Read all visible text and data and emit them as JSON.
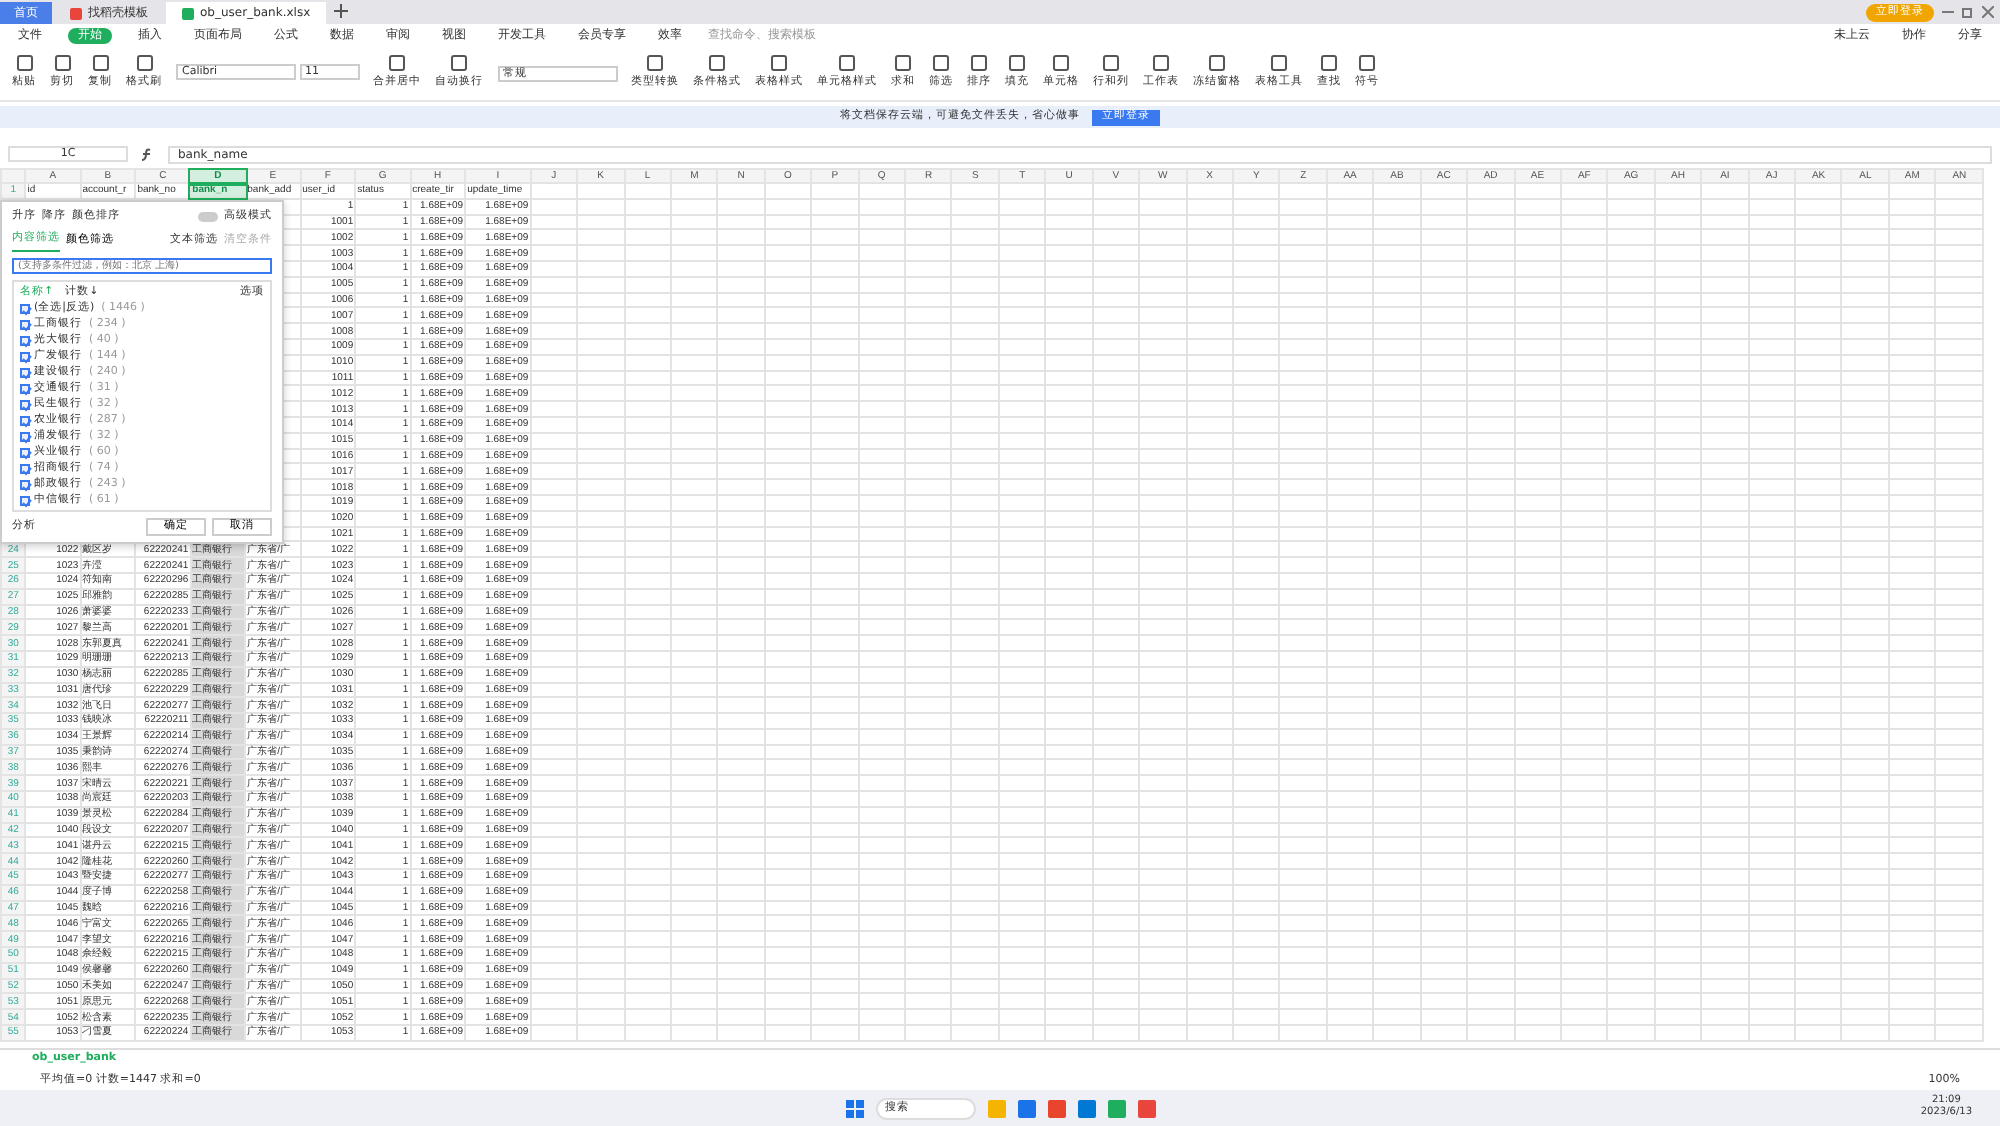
{
  "tabs": [
    {
      "label": "首页",
      "selected": false,
      "kind": "home"
    },
    {
      "label": "找稻壳模板",
      "selected": false,
      "kind": "template"
    },
    {
      "label": "ob_user_bank.xlsx",
      "selected": true,
      "kind": "sheet"
    }
  ],
  "login_button": "立即登录",
  "menu": {
    "file": "文件",
    "items": [
      {
        "label": "开始",
        "selected": true
      },
      {
        "label": "插入",
        "selected": false
      },
      {
        "label": "页面布局",
        "selected": false
      },
      {
        "label": "公式",
        "selected": false
      },
      {
        "label": "数据",
        "selected": false
      },
      {
        "label": "审阅",
        "selected": false
      },
      {
        "label": "视图",
        "selected": false
      },
      {
        "label": "开发工具",
        "selected": false
      },
      {
        "label": "会员专享",
        "selected": false
      },
      {
        "label": "效率",
        "selected": false
      }
    ],
    "search_placeholder": "查找命令、搜索模板",
    "actions": [
      "未上云",
      "协作",
      "分享"
    ]
  },
  "ribbon": {
    "clipboard": [
      "粘贴",
      "剪切",
      "复制",
      "格式刷"
    ],
    "font_name": "Calibri",
    "font_size": "11",
    "align": [
      "合并居中",
      "自动换行"
    ],
    "number_format": "常规",
    "tools": [
      "类型转换",
      "条件格式",
      "表格样式",
      "单元格样式",
      "求和",
      "筛选",
      "排序",
      "填充",
      "单元格",
      "行和列",
      "工作表",
      "冻结窗格",
      "表格工具",
      "查找",
      "符号"
    ]
  },
  "notice": {
    "text": "将文档保存云端，可避免文件丢失，省心做事",
    "button": "立即登录"
  },
  "name_box": "1C",
  "formula": "bank_name",
  "columns": [
    {
      "label": "A",
      "selected": false
    },
    {
      "label": "B",
      "selected": false
    },
    {
      "label": "C",
      "selected": false
    },
    {
      "label": "D",
      "selected": true
    },
    {
      "label": "E",
      "selected": false
    },
    {
      "label": "F",
      "selected": false
    },
    {
      "label": "G",
      "selected": false
    },
    {
      "label": "H",
      "selected": false
    },
    {
      "label": "I",
      "selected": false
    },
    {
      "label": "J",
      "selected": false
    },
    {
      "label": "K",
      "selected": false
    },
    {
      "label": "L",
      "selected": false
    },
    {
      "label": "M",
      "selected": false
    },
    {
      "label": "N",
      "selected": false
    },
    {
      "label": "O",
      "selected": false
    },
    {
      "label": "P",
      "selected": false
    },
    {
      "label": "Q",
      "selected": false
    },
    {
      "label": "R",
      "selected": false
    },
    {
      "label": "S",
      "selected": false
    },
    {
      "label": "T",
      "selected": false
    },
    {
      "label": "U",
      "selected": false
    },
    {
      "label": "V",
      "selected": false
    },
    {
      "label": "W",
      "selected": false
    },
    {
      "label": "X",
      "selected": false
    },
    {
      "label": "Y",
      "selected": false
    },
    {
      "label": "Z",
      "selected": false
    },
    {
      "label": "AA",
      "selected": false
    },
    {
      "label": "AB",
      "selected": false
    },
    {
      "label": "AC",
      "selected": false
    },
    {
      "label": "AD",
      "selected": false
    },
    {
      "label": "AE",
      "selected": false
    },
    {
      "label": "AF",
      "selected": false
    },
    {
      "label": "AG",
      "selected": false
    },
    {
      "label": "AH",
      "selected": false
    },
    {
      "label": "AI",
      "selected": false
    },
    {
      "label": "AJ",
      "selected": false
    },
    {
      "label": "AK",
      "selected": false
    },
    {
      "label": "AL",
      "selected": false
    },
    {
      "label": "AM",
      "selected": false
    },
    {
      "label": "AN",
      "selected": false
    }
  ],
  "header_row_number": "1",
  "header_row": [
    "id",
    "account_r",
    "bank_no",
    "bank_n",
    "bank_add",
    "user_id",
    "status",
    "create_tir",
    "update_time"
  ],
  "rows": [
    {
      "cells": [
        "1",
        "1",
        "1.68E+09",
        "1.68E+09"
      ]
    },
    {
      "cells": [
        "1001",
        "1",
        "1.68E+09",
        "1.68E+09"
      ]
    },
    {
      "cells": [
        "1002",
        "1",
        "1.68E+09",
        "1.68E+09"
      ]
    },
    {
      "cells": [
        "1003",
        "1",
        "1.68E+09",
        "1.68E+09"
      ]
    },
    {
      "cells": [
        "1004",
        "1",
        "1.68E+09",
        "1.68E+09"
      ]
    },
    {
      "cells": [
        "1005",
        "1",
        "1.68E+09",
        "1.68E+09"
      ]
    },
    {
      "cells": [
        "1006",
        "1",
        "1.68E+09",
        "1.68E+09"
      ]
    },
    {
      "cells": [
        "1007",
        "1",
        "1.68E+09",
        "1.68E+09"
      ]
    },
    {
      "cells": [
        "1008",
        "1",
        "1.68E+09",
        "1.68E+09"
      ]
    },
    {
      "cells": [
        "1009",
        "1",
        "1.68E+09",
        "1.68E+09"
      ]
    },
    {
      "cells": [
        "1010",
        "1",
        "1.68E+09",
        "1.68E+09"
      ]
    },
    {
      "cells": [
        "1011",
        "1",
        "1.68E+09",
        "1.68E+09"
      ]
    },
    {
      "cells": [
        "1012",
        "1",
        "1.68E+09",
        "1.68E+09"
      ]
    },
    {
      "cells": [
        "1013",
        "1",
        "1.68E+09",
        "1.68E+09"
      ]
    },
    {
      "cells": [
        "1014",
        "1",
        "1.68E+09",
        "1.68E+09"
      ]
    },
    {
      "cells": [
        "1015",
        "1",
        "1.68E+09",
        "1.68E+09"
      ]
    },
    {
      "cells": [
        "1016",
        "1",
        "1.68E+09",
        "1.68E+09"
      ]
    },
    {
      "cells": [
        "1017",
        "1",
        "1.68E+09",
        "1.68E+09"
      ]
    },
    {
      "cells": [
        "1018",
        "1",
        "1.68E+09",
        "1.68E+09"
      ]
    },
    {
      "cells": [
        "1019",
        "1",
        "1.68E+09",
        "1.68E+09"
      ]
    },
    {
      "cells": [
        "1020",
        "1",
        "1.68E+09",
        "1.68E+09"
      ]
    },
    {
      "cells": [
        "1021",
        "1",
        "1.68E+09",
        "1.68E+09"
      ]
    },
    {
      "n": "24",
      "cells": [
        "1022",
        "戴区岁",
        "62220241",
        "工商银行",
        "广东省/广",
        "1022",
        "1",
        "1.68E+09",
        "1.68E+09"
      ]
    },
    {
      "n": "25",
      "cells": [
        "1023",
        "卉滢",
        "62220241",
        "工商银行",
        "广东省/广",
        "1023",
        "1",
        "1.68E+09",
        "1.68E+09"
      ]
    },
    {
      "n": "26",
      "cells": [
        "1024",
        "符知南",
        "62220296",
        "工商银行",
        "广东省/广",
        "1024",
        "1",
        "1.68E+09",
        "1.68E+09"
      ]
    },
    {
      "n": "27",
      "cells": [
        "1025",
        "邱雅韵",
        "62220285",
        "工商银行",
        "广东省/广",
        "1025",
        "1",
        "1.68E+09",
        "1.68E+09"
      ]
    },
    {
      "n": "28",
      "cells": [
        "1026",
        "萧婆婆",
        "62220233",
        "工商银行",
        "广东省/广",
        "1026",
        "1",
        "1.68E+09",
        "1.68E+09"
      ]
    },
    {
      "n": "29",
      "cells": [
        "1027",
        "黎兰高",
        "62220201",
        "工商银行",
        "广东省/广",
        "1027",
        "1",
        "1.68E+09",
        "1.68E+09"
      ]
    },
    {
      "n": "30",
      "cells": [
        "1028",
        "东郭夏真",
        "62220241",
        "工商银行",
        "广东省/广",
        "1028",
        "1",
        "1.68E+09",
        "1.68E+09"
      ]
    },
    {
      "n": "31",
      "cells": [
        "1029",
        "明珊珊",
        "62220213",
        "工商银行",
        "广东省/广",
        "1029",
        "1",
        "1.68E+09",
        "1.68E+09"
      ]
    },
    {
      "n": "32",
      "cells": [
        "1030",
        "杨志丽",
        "62220285",
        "工商银行",
        "广东省/广",
        "1030",
        "1",
        "1.68E+09",
        "1.68E+09"
      ]
    },
    {
      "n": "33",
      "cells": [
        "1031",
        "唐代珍",
        "62220229",
        "工商银行",
        "广东省/广",
        "1031",
        "1",
        "1.68E+09",
        "1.68E+09"
      ]
    },
    {
      "n": "34",
      "cells": [
        "1032",
        "池飞日",
        "62220277",
        "工商银行",
        "广东省/广",
        "1032",
        "1",
        "1.68E+09",
        "1.68E+09"
      ]
    },
    {
      "n": "35",
      "cells": [
        "1033",
        "钱映冰",
        "62220211",
        "工商银行",
        "广东省/广",
        "1033",
        "1",
        "1.68E+09",
        "1.68E+09"
      ]
    },
    {
      "n": "36",
      "cells": [
        "1034",
        "王景辉",
        "62220214",
        "工商银行",
        "广东省/广",
        "1034",
        "1",
        "1.68E+09",
        "1.68E+09"
      ]
    },
    {
      "n": "37",
      "cells": [
        "1035",
        "秉韵诗",
        "62220274",
        "工商银行",
        "广东省/广",
        "1035",
        "1",
        "1.68E+09",
        "1.68E+09"
      ]
    },
    {
      "n": "38",
      "cells": [
        "1036",
        "熙丰",
        "62220276",
        "工商银行",
        "广东省/广",
        "1036",
        "1",
        "1.68E+09",
        "1.68E+09"
      ]
    },
    {
      "n": "39",
      "cells": [
        "1037",
        "宋晴云",
        "62220221",
        "工商银行",
        "广东省/广",
        "1037",
        "1",
        "1.68E+09",
        "1.68E+09"
      ]
    },
    {
      "n": "40",
      "cells": [
        "1038",
        "尚宸廷",
        "62220203",
        "工商银行",
        "广东省/广",
        "1038",
        "1",
        "1.68E+09",
        "1.68E+09"
      ]
    },
    {
      "n": "41",
      "cells": [
        "1039",
        "景灵松",
        "62220284",
        "工商银行",
        "广东省/广",
        "1039",
        "1",
        "1.68E+09",
        "1.68E+09"
      ]
    },
    {
      "n": "42",
      "cells": [
        "1040",
        "段设文",
        "62220207",
        "工商银行",
        "广东省/广",
        "1040",
        "1",
        "1.68E+09",
        "1.68E+09"
      ]
    },
    {
      "n": "43",
      "cells": [
        "1041",
        "谌丹云",
        "62220215",
        "工商银行",
        "广东省/广",
        "1041",
        "1",
        "1.68E+09",
        "1.68E+09"
      ]
    },
    {
      "n": "44",
      "cells": [
        "1042",
        "隆桂花",
        "62220260",
        "工商银行",
        "广东省/广",
        "1042",
        "1",
        "1.68E+09",
        "1.68E+09"
      ]
    },
    {
      "n": "45",
      "cells": [
        "1043",
        "暨安捷",
        "62220277",
        "工商银行",
        "广东省/广",
        "1043",
        "1",
        "1.68E+09",
        "1.68E+09"
      ]
    },
    {
      "n": "46",
      "cells": [
        "1044",
        "度子博",
        "62220258",
        "工商银行",
        "广东省/广",
        "1044",
        "1",
        "1.68E+09",
        "1.68E+09"
      ]
    },
    {
      "n": "47",
      "cells": [
        "1045",
        "魏晗",
        "62220216",
        "工商银行",
        "广东省/广",
        "1045",
        "1",
        "1.68E+09",
        "1.68E+09"
      ]
    },
    {
      "n": "48",
      "cells": [
        "1046",
        "宁富文",
        "62220265",
        "工商银行",
        "广东省/广",
        "1046",
        "1",
        "1.68E+09",
        "1.68E+09"
      ]
    },
    {
      "n": "49",
      "cells": [
        "1047",
        "李望文",
        "62220216",
        "工商银行",
        "广东省/广",
        "1047",
        "1",
        "1.68E+09",
        "1.68E+09"
      ]
    },
    {
      "n": "50",
      "cells": [
        "1048",
        "佘经毅",
        "62220215",
        "工商银行",
        "广东省/广",
        "1048",
        "1",
        "1.68E+09",
        "1.68E+09"
      ]
    },
    {
      "n": "51",
      "cells": [
        "1049",
        "侯馨馨",
        "62220260",
        "工商银行",
        "广东省/广",
        "1049",
        "1",
        "1.68E+09",
        "1.68E+09"
      ]
    },
    {
      "n": "52",
      "cells": [
        "1050",
        "禾美如",
        "62220247",
        "工商银行",
        "广东省/广",
        "1050",
        "1",
        "1.68E+09",
        "1.68E+09"
      ]
    },
    {
      "n": "53",
      "cells": [
        "1051",
        "原思元",
        "62220268",
        "工商银行",
        "广东省/广",
        "1051",
        "1",
        "1.68E+09",
        "1.68E+09"
      ]
    },
    {
      "n": "54",
      "cells": [
        "1052",
        "松含素",
        "62220235",
        "工商银行",
        "广东省/广",
        "1052",
        "1",
        "1.68E+09",
        "1.68E+09"
      ]
    },
    {
      "n": "55",
      "cells": [
        "1053",
        "刁雪夏",
        "62220224",
        "工商银行",
        "广东省/广",
        "1053",
        "1",
        "1.68E+09",
        "1.68E+09"
      ]
    }
  ],
  "filter": {
    "sort": [
      "升序",
      "降序",
      "颜色排序"
    ],
    "advanced": "高级模式",
    "advanced_on": false,
    "tabs": [
      {
        "label": "内容筛选",
        "selected": true
      },
      {
        "label": "颜色筛选",
        "selected": false
      }
    ],
    "text_filter": "文本筛选",
    "clear": "清空条件",
    "search_placeholder": "(支持多条件过滤，例如：北京 上海)",
    "name_sort": "名称↑",
    "count_sort": "计数↓",
    "options": "选项",
    "items": [
      {
        "label": "(全选|反选)",
        "count": "( 1446 )",
        "checked": true
      },
      {
        "label": "工商银行",
        "count": "( 234 )",
        "checked": true
      },
      {
        "label": "光大银行",
        "count": "( 40 )",
        "checked": true
      },
      {
        "label": "广发银行",
        "count": "( 144 )",
        "checked": true
      },
      {
        "label": "建设银行",
        "count": "( 240 )",
        "checked": true
      },
      {
        "label": "交通银行",
        "count": "( 31 )",
        "checked": true
      },
      {
        "label": "民生银行",
        "count": "( 32 )",
        "checked": true
      },
      {
        "label": "农业银行",
        "count": "( 287 )",
        "checked": true
      },
      {
        "label": "浦发银行",
        "count": "( 32 )",
        "checked": true
      },
      {
        "label": "兴业银行",
        "count": "( 60 )",
        "checked": true
      },
      {
        "label": "招商银行",
        "count": "( 74 )",
        "checked": true
      },
      {
        "label": "邮政银行",
        "count": "( 243 )",
        "checked": true
      },
      {
        "label": "中信银行",
        "count": "( 61 )",
        "checked": true
      }
    ],
    "analyze": "分析",
    "ok": "确定",
    "cancel": "取消"
  },
  "sheet_tabs": [
    {
      "label": "ob_user_bank",
      "selected": true
    }
  ],
  "status": "平均值=0  计数=1447  求和=0",
  "zoom": "100%",
  "taskbar": {
    "search": "搜索",
    "time": "21:09",
    "date": "2023/6/13"
  }
}
